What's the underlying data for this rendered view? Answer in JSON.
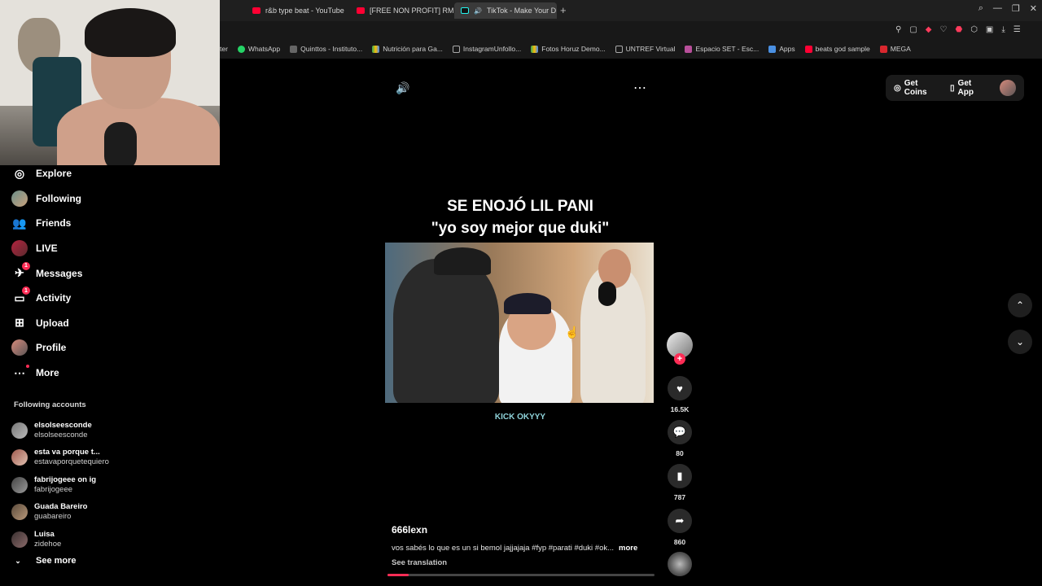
{
  "browser": {
    "tabs": [
      {
        "title": "r&b type beat - YouTube",
        "active": false
      },
      {
        "title": "[FREE NON PROFIT] RM",
        "active": false
      },
      {
        "title": "TikTok - Make Your D",
        "active": true
      }
    ],
    "bookmarks": [
      {
        "label": "ter",
        "icon": "doc-icon"
      },
      {
        "label": "WhatsApp",
        "icon": "whatsapp-icon"
      },
      {
        "label": "Quinttos - Instituto...",
        "icon": "site-icon"
      },
      {
        "label": "Nutrición para Ga...",
        "icon": "drive-icon"
      },
      {
        "label": "InstagramUnfollo...",
        "icon": "doc-icon"
      },
      {
        "label": "Fotos Horuz Demo...",
        "icon": "drive-icon"
      },
      {
        "label": "UNTREF Virtual",
        "icon": "doc-icon"
      },
      {
        "label": "Espacio SET - Esc...",
        "icon": "set-icon"
      },
      {
        "label": "Apps",
        "icon": "apps-icon"
      },
      {
        "label": "beats god sample",
        "icon": "youtube-icon"
      },
      {
        "label": "MEGA",
        "icon": "mega-icon"
      }
    ]
  },
  "sidebar": {
    "items": [
      {
        "label": "Explore",
        "icon": "compass-icon"
      },
      {
        "label": "Following",
        "icon": "following-avatar-icon"
      },
      {
        "label": "Friends",
        "icon": "friends-icon"
      },
      {
        "label": "LIVE",
        "icon": "live-icon"
      },
      {
        "label": "Messages",
        "icon": "messages-icon",
        "badge": "1"
      },
      {
        "label": "Activity",
        "icon": "activity-icon",
        "badge": "1"
      },
      {
        "label": "Upload",
        "icon": "upload-icon"
      },
      {
        "label": "Profile",
        "icon": "profile-avatar-icon"
      },
      {
        "label": "More",
        "icon": "more-icon"
      }
    ],
    "following_title": "Following accounts",
    "accounts": [
      {
        "name": "elsolseesconde",
        "handle": "elsolseesconde"
      },
      {
        "name": "esta va porque t...",
        "handle": "estavaporquetequiero"
      },
      {
        "name": "fabrijogeee on ig",
        "handle": "fabrijogeee"
      },
      {
        "name": "Guada Bareiro",
        "handle": "guabareiro"
      },
      {
        "name": "Luisa",
        "handle": "zidehoe"
      }
    ],
    "see_more": "See more"
  },
  "topbar": {
    "get_coins": "Get Coins",
    "get_app": "Get App"
  },
  "video": {
    "headline_line1": "SE ENOJÓ LIL PANI",
    "headline_line2": "\"yo soy mejor que duki\"",
    "caption": "KICK OKYYY",
    "author": "666lexn",
    "description": "vos sabés lo que es un si bemol jajjajaja #fyp #parati #duki #ok...",
    "more": "more",
    "see_translation": "See translation",
    "progress": 0.08
  },
  "actions": {
    "likes": "16.5K",
    "comments": "80",
    "saves": "787",
    "shares": "860"
  }
}
